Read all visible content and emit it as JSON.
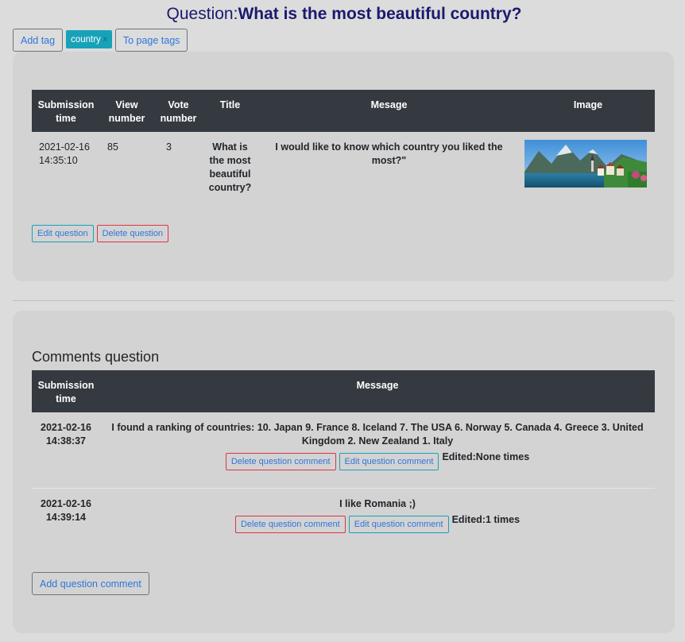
{
  "header": {
    "prefix": "Question:",
    "question_title": "What is the most beautiful country?"
  },
  "tags": {
    "add_label": "Add tag",
    "chips": [
      {
        "label": "country",
        "remove": "x"
      }
    ],
    "to_page_label": "To page tags"
  },
  "question": {
    "columns": [
      "Submission time",
      "View number",
      "Vote number",
      "Title",
      "Mesage",
      "Image"
    ],
    "row": {
      "submission_time": "2021-02-16 14:35:10",
      "view_number": "85",
      "vote_number": "3",
      "title": "What is the most beautiful country?",
      "message": "I would like to know which country you liked the most?\""
    },
    "image_icon": "landscape-photo",
    "edit_label": "Edit question",
    "delete_label": "Delete question"
  },
  "comments": {
    "heading": "Comments question",
    "columns": [
      "Submission time",
      "Message"
    ],
    "rows": [
      {
        "submission_time": "2021-02-16 14:38:37",
        "message": "I found a ranking of countries: 10. Japan 9. France 8. Iceland 7. The USA 6. Norway 5. Canada 4. Greece 3. United Kingdom 2. New Zealand 1. Italy",
        "delete_label": "Delete question comment",
        "edit_label": "Edit question comment",
        "edited": "Edited:None times"
      },
      {
        "submission_time": "2021-02-16 14:39:14",
        "message": "I like Romania ;)",
        "delete_label": "Delete question comment",
        "edit_label": "Edit question comment",
        "edited": "Edited:1 times"
      }
    ],
    "add_label": "Add question comment"
  },
  "colors": {
    "page_bg": "#dcdcdc",
    "panel_bg": "#d3d3d3",
    "table_header": "#343a40",
    "title_color": "#1a1a6e",
    "tag_chip": "#17a2b8",
    "danger": "#dc3545",
    "info": "#17a2b8",
    "link": "#2f76d9"
  }
}
